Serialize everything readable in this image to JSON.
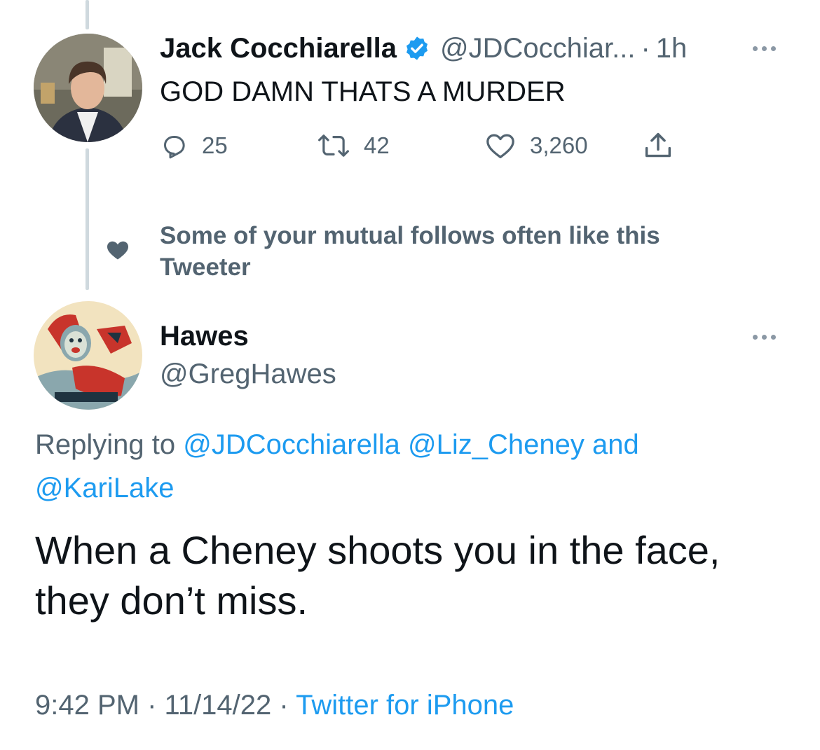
{
  "tweet1": {
    "name": "Jack Cocchiarella",
    "handle": "@JDCocchiar...",
    "separator": "·",
    "time": "1h",
    "text": "GOD DAMN THATS A MURDER",
    "actions": {
      "replies": "25",
      "retweets": "42",
      "likes": "3,260"
    },
    "verified": true,
    "verified_color": "#1d9bf0"
  },
  "social_context": {
    "text": "Some of your mutual follows often like this Tweeter",
    "icon": "heart-icon"
  },
  "tweet2": {
    "name": "Hawes",
    "handle": "@GregHawes",
    "replying_prefix": "Replying to",
    "reply_mention1": "@JDCocchiarella",
    "reply_mention2": "@Liz_Cheney",
    "reply_and": "and",
    "reply_mention3": "@KariLake",
    "text": "When a Cheney shoots you in the face, they don’t miss.",
    "time": "9:42 PM",
    "sep": "·",
    "date": "11/14/22",
    "source": "Twitter for iPhone"
  },
  "colors": {
    "accent": "#1d9bf0",
    "muted": "#536471",
    "text": "#0f1419",
    "thread_line": "#cfd9de"
  }
}
